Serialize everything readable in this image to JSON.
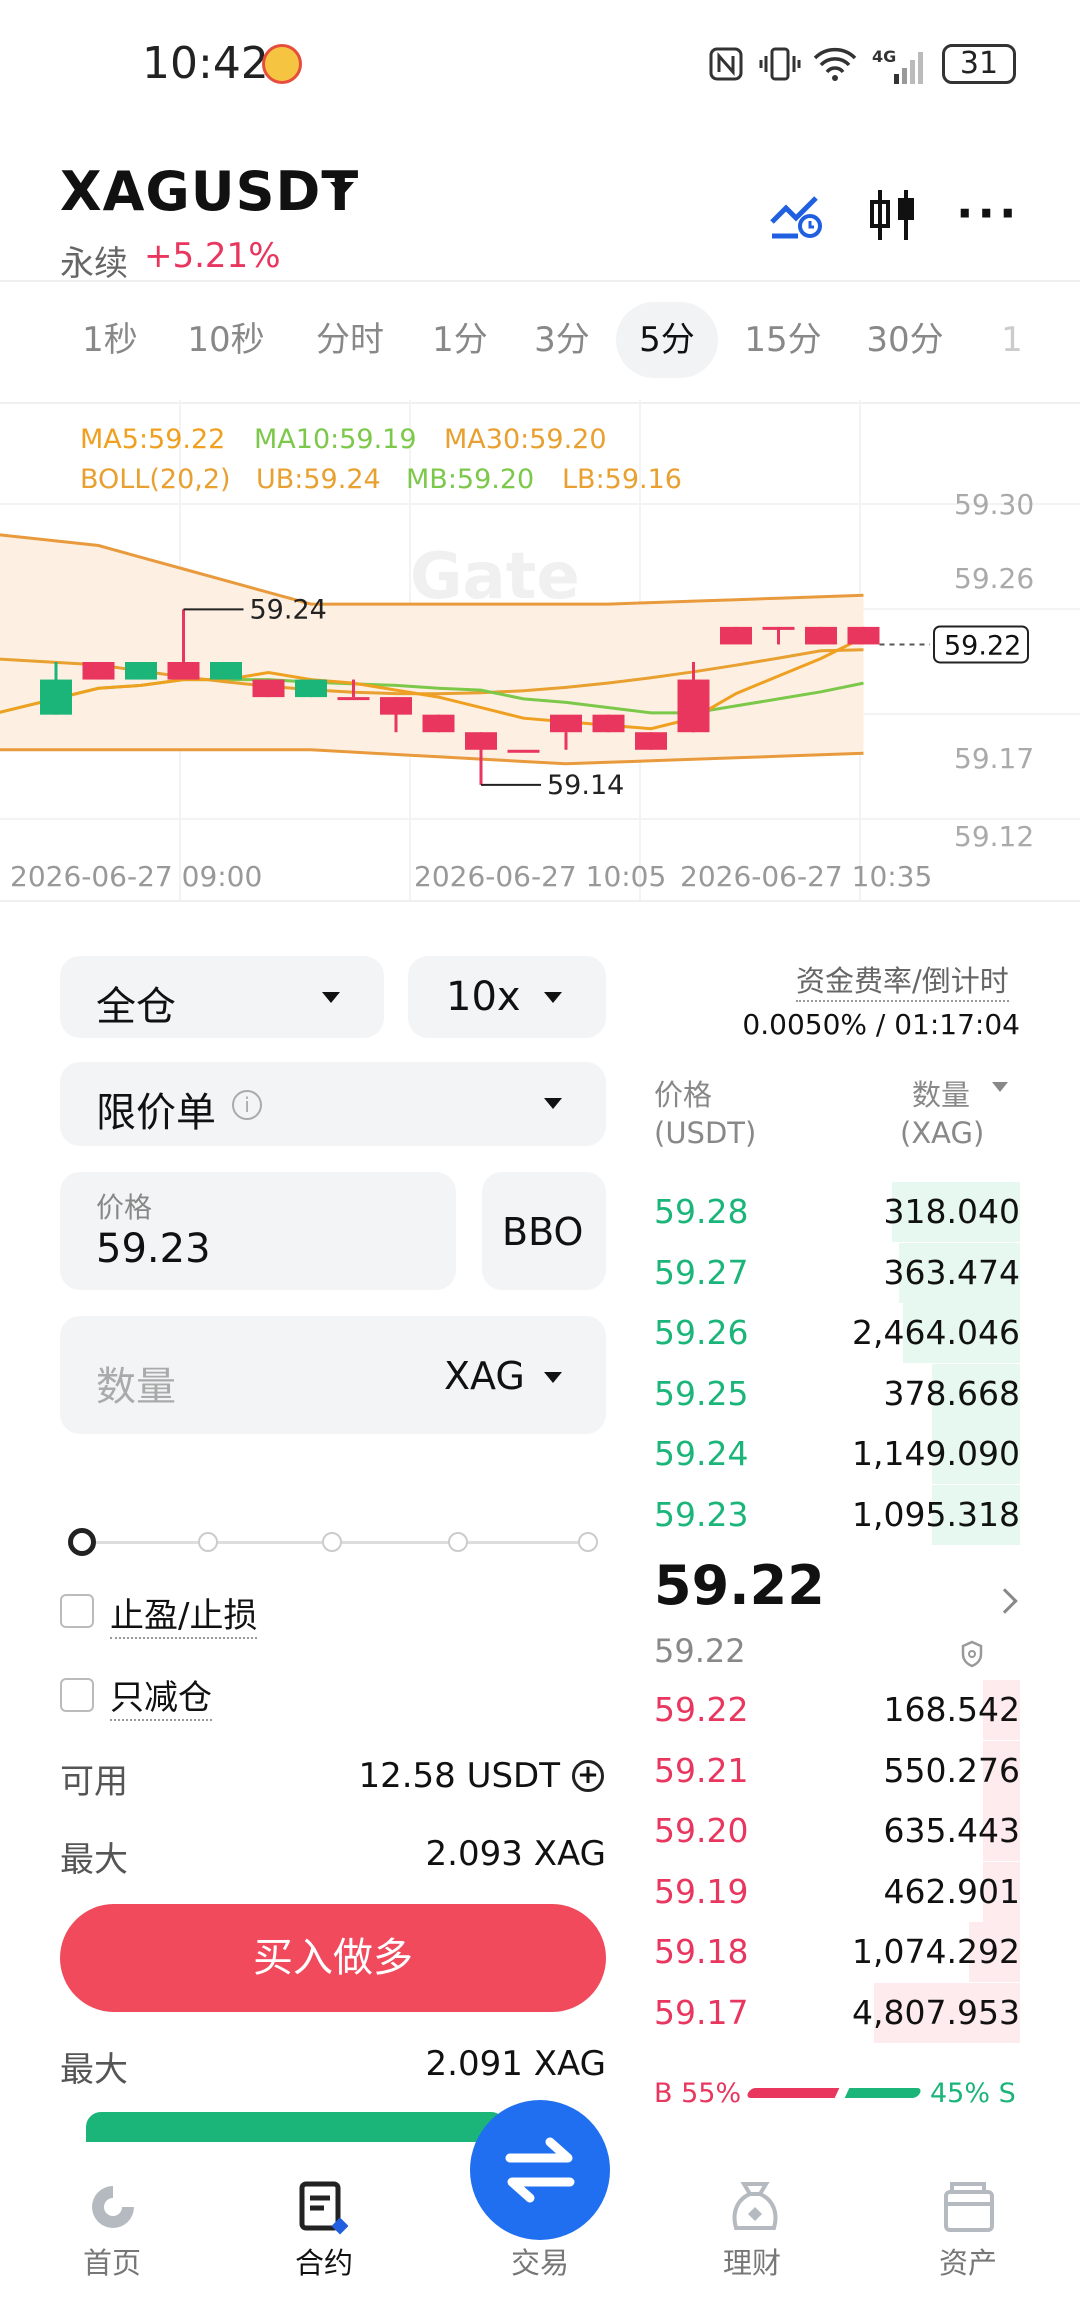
{
  "status_bar": {
    "time": "10:42",
    "battery": "31",
    "network": "4G"
  },
  "header": {
    "symbol": "XAGUSDT",
    "contract_type": "永续",
    "change": "+5.21%"
  },
  "intervals": [
    {
      "label": "1秒",
      "active": false
    },
    {
      "label": "10秒",
      "active": false
    },
    {
      "label": "分时",
      "active": false
    },
    {
      "label": "1分",
      "active": false
    },
    {
      "label": "3分",
      "active": false
    },
    {
      "label": "5分",
      "active": true
    },
    {
      "label": "15分",
      "active": false
    },
    {
      "label": "30分",
      "active": false
    },
    {
      "label": "1",
      "active": false
    }
  ],
  "chart": {
    "legend_ma": [
      "MA5:59.22",
      "MA10:59.19",
      "MA30:59.20"
    ],
    "legend_boll": [
      "BOLL(20,2)",
      "UB:59.24",
      "MB:59.20",
      "LB:59.16"
    ],
    "y_ticks": [
      "59.30",
      "59.26",
      "59.17",
      "59.12"
    ],
    "x_ticks": [
      "2026-06-27 09:00",
      "2026-06-27 10:05",
      "2026-06-27 10:35"
    ],
    "high_label": "59.24",
    "low_label": "59.14",
    "last_price_tag": "59.22",
    "watermark": "Gate",
    "colors": {
      "up": "#e8365f",
      "down": "#1bb57a",
      "ma5": "#f0a020",
      "ma10": "#7cc84a",
      "ma30": "#e8a030",
      "boll": "#e89a3c",
      "boll_fill": "#fdf0e2"
    }
  },
  "chart_data": {
    "type": "candlestick",
    "candles": [
      {
        "o": 59.2,
        "h": 59.21,
        "l": 59.18,
        "c": 59.18
      },
      {
        "o": 59.2,
        "h": 59.21,
        "l": 59.2,
        "c": 59.21
      },
      {
        "o": 59.21,
        "h": 59.21,
        "l": 59.2,
        "c": 59.2
      },
      {
        "o": 59.2,
        "h": 59.24,
        "l": 59.2,
        "c": 59.21
      },
      {
        "o": 59.21,
        "h": 59.21,
        "l": 59.2,
        "c": 59.2
      },
      {
        "o": 59.19,
        "h": 59.2,
        "l": 59.19,
        "c": 59.2
      },
      {
        "o": 59.2,
        "h": 59.2,
        "l": 59.19,
        "c": 59.19
      },
      {
        "o": 59.19,
        "h": 59.2,
        "l": 59.19,
        "c": 59.19
      },
      {
        "o": 59.18,
        "h": 59.19,
        "l": 59.17,
        "c": 59.19
      },
      {
        "o": 59.17,
        "h": 59.18,
        "l": 59.17,
        "c": 59.18
      },
      {
        "o": 59.16,
        "h": 59.17,
        "l": 59.14,
        "c": 59.17
      },
      {
        "o": 59.16,
        "h": 59.16,
        "l": 59.16,
        "c": 59.16
      },
      {
        "o": 59.17,
        "h": 59.17,
        "l": 59.16,
        "c": 59.18
      },
      {
        "o": 59.17,
        "h": 59.18,
        "l": 59.17,
        "c": 59.18
      },
      {
        "o": 59.16,
        "h": 59.17,
        "l": 59.16,
        "c": 59.17
      },
      {
        "o": 59.17,
        "h": 59.21,
        "l": 59.17,
        "c": 59.2
      },
      {
        "o": 59.22,
        "h": 59.23,
        "l": 59.22,
        "c": 59.23
      },
      {
        "o": 59.23,
        "h": 59.23,
        "l": 59.22,
        "c": 59.23
      },
      {
        "o": 59.22,
        "h": 59.23,
        "l": 59.22,
        "c": 59.23
      },
      {
        "o": 59.22,
        "h": 59.23,
        "l": 59.22,
        "c": 59.23
      }
    ]
  },
  "funding": {
    "label": "资金费率/倒计时",
    "value": "0.0050% / 01:17:04"
  },
  "order_form": {
    "margin_mode": "全仓",
    "leverage": "10x",
    "order_type": "限价单",
    "price_label": "价格",
    "price_value": "59.23",
    "bbo_label": "BBO",
    "qty_placeholder": "数量",
    "qty_unit": "XAG",
    "tp_sl_label": "止盈/止损",
    "reduce_only_label": "只减仓",
    "avail_label": "可用",
    "avail_value": "12.58 USDT",
    "max_label": "最大",
    "max_buy_value": "2.093 XAG",
    "buy_button": "买入做多",
    "max_sell_value": "2.091 XAG"
  },
  "order_book": {
    "price_header": "价格",
    "price_unit": "(USDT)",
    "qty_header": "数量",
    "qty_unit": "(XAG)",
    "asks": [
      {
        "price": "59.28",
        "qty": "318.040",
        "depth": 0.35
      },
      {
        "price": "59.27",
        "qty": "363.474",
        "depth": 0.33
      },
      {
        "price": "59.26",
        "qty": "2,464.046",
        "depth": 0.32
      },
      {
        "price": "59.25",
        "qty": "378.668",
        "depth": 0.24
      },
      {
        "price": "59.24",
        "qty": "1,149.090",
        "depth": 0.24
      },
      {
        "price": "59.23",
        "qty": "1,095.318",
        "depth": 0.24
      }
    ],
    "last_price": "59.22",
    "mark_price": "59.22",
    "bids": [
      {
        "price": "59.22",
        "qty": "168.542",
        "depth": 0.1
      },
      {
        "price": "59.21",
        "qty": "550.276",
        "depth": 0.1
      },
      {
        "price": "59.20",
        "qty": "635.443",
        "depth": 0.1
      },
      {
        "price": "59.19",
        "qty": "462.901",
        "depth": 0.1
      },
      {
        "price": "59.18",
        "qty": "1,074.292",
        "depth": 0.14
      },
      {
        "price": "59.17",
        "qty": "4,807.953",
        "depth": 0.4
      }
    ],
    "buy_ratio_label": "B 55%",
    "sell_ratio_label": "45% S",
    "buy_ratio": 0.55
  },
  "nav": [
    {
      "label": "首页",
      "icon": "home-icon"
    },
    {
      "label": "合约",
      "icon": "contract-icon"
    },
    {
      "label": "交易",
      "icon": "swap-icon"
    },
    {
      "label": "理财",
      "icon": "finance-icon"
    },
    {
      "label": "资产",
      "icon": "wallet-icon"
    }
  ]
}
